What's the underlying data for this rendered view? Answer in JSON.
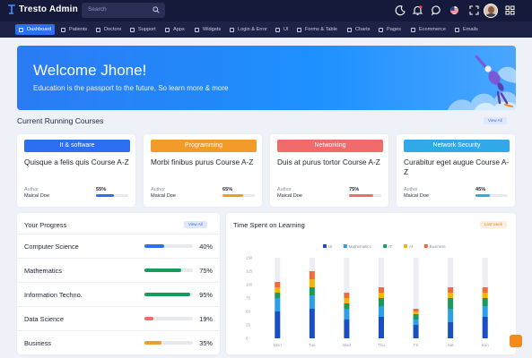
{
  "app": {
    "brand": "Tresto Admin",
    "search_placeholder": "Search"
  },
  "topbar_icons": [
    "moon-icon",
    "bell-icon",
    "chat-icon",
    "flag-icon",
    "fullscreen-icon",
    "grid-icon"
  ],
  "nav": [
    {
      "label": "Dashboard",
      "active": true
    },
    {
      "label": "Patients"
    },
    {
      "label": "Doctors"
    },
    {
      "label": "Support"
    },
    {
      "label": "Apps"
    },
    {
      "label": "Widgets"
    },
    {
      "label": "Login & Error"
    },
    {
      "label": "UI"
    },
    {
      "label": "Forms & Table"
    },
    {
      "label": "Charts"
    },
    {
      "label": "Pages"
    },
    {
      "label": "Ecommerce"
    },
    {
      "label": "Emails"
    }
  ],
  "banner": {
    "title": "Welcome Jhone!",
    "subtitle": "Education is the passport to the future, So learn more & more"
  },
  "courses_section": {
    "title": "Current Running Courses",
    "view_all": "View All"
  },
  "courses": [
    {
      "tag": "It & software",
      "name": "Quisque a felis quis Course A-Z",
      "author_label": "Author",
      "author": "Maical Doe",
      "progress": "55%",
      "value": 55,
      "color": "#2d6ff1"
    },
    {
      "tag": "Programming",
      "name": "Morbi finibus purus Course A-Z",
      "author_label": "Author",
      "author": "Maical Doe",
      "progress": "65%",
      "value": 65,
      "color": "#f29a2a"
    },
    {
      "tag": "Networking",
      "name": "Duis at purus tortor Course A-Z",
      "author_label": "Author",
      "author": "Maical Doe",
      "progress": "75%",
      "value": 75,
      "color": "#f26a6a"
    },
    {
      "tag": "Network Security",
      "name": "Curabitur eget augue Course A-Z",
      "author_label": "Author",
      "author": "Maical Doe",
      "progress": "45%",
      "value": 45,
      "color": "#31a8e8"
    }
  ],
  "progress": {
    "title": "Your Progress",
    "view_all": "View All",
    "rows": [
      {
        "label": "Computer Science",
        "value_text": "40%",
        "value": 40,
        "color": "#2d6ff1"
      },
      {
        "label": "Mathematics",
        "value_text": "75%",
        "value": 75,
        "color": "#1a9a5b"
      },
      {
        "label": "Information Techno.",
        "value_text": "95%",
        "value": 95,
        "color": "#1a9a5b"
      },
      {
        "label": "Data Science",
        "value_text": "19%",
        "value": 19,
        "color": "#f26a6a"
      },
      {
        "label": "Business",
        "value_text": "35%",
        "value": 35,
        "color": "#f29a2a"
      }
    ]
  },
  "time_chart": {
    "title": "Time Spent on Learning",
    "filter_label": "Last week"
  },
  "chart_data": {
    "type": "bar",
    "stacked": true,
    "title": "Time Spent on Learning",
    "categories": [
      "Mon",
      "Tue",
      "Wed",
      "Thu",
      "Fri",
      "Sat",
      "Sun"
    ],
    "ylim": [
      0,
      150
    ],
    "yticks": [
      0,
      25,
      50,
      75,
      100,
      125,
      150
    ],
    "series": [
      {
        "name": "UI",
        "color": "#1a4fc4",
        "values": [
          50,
          55,
          35,
          40,
          25,
          30,
          40
        ]
      },
      {
        "name": "Mathematics",
        "color": "#2aa0e6",
        "values": [
          25,
          25,
          20,
          20,
          10,
          25,
          20
        ]
      },
      {
        "name": "IT",
        "color": "#1a9a5b",
        "values": [
          10,
          15,
          10,
          15,
          10,
          20,
          15
        ]
      },
      {
        "name": "AI",
        "color": "#f2b705",
        "values": [
          10,
          15,
          10,
          10,
          5,
          10,
          10
        ]
      },
      {
        "name": "Business",
        "color": "#f26a3a",
        "values": [
          10,
          15,
          10,
          10,
          5,
          10,
          10
        ]
      }
    ],
    "totals": [
      150,
      150,
      150,
      150,
      150,
      150,
      150
    ]
  }
}
